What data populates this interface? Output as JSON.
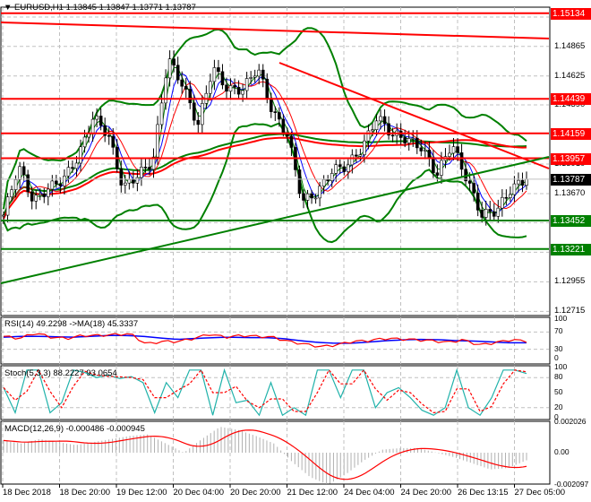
{
  "header": {
    "symbol": "EURUSD,H1",
    "ohlc": "1.13845 1.13847 1.13771 1.13787"
  },
  "price_axis": {
    "ticks": [
      "1.15103",
      "1.14865",
      "1.14625",
      "1.14390",
      "1.13910",
      "1.13670",
      "1.13435",
      "1.13195",
      "1.12955",
      "1.12715"
    ],
    "tags": [
      {
        "v": "1.15134",
        "price": 1.15134,
        "color": "#ff0000"
      },
      {
        "v": "1.14439",
        "price": 1.14439,
        "color": "#ff0000"
      },
      {
        "v": "1.14159",
        "price": 1.14159,
        "color": "#ff0000"
      },
      {
        "v": "1.13957",
        "price": 1.13957,
        "color": "#ff0000"
      },
      {
        "v": "1.13787",
        "price": 1.13787,
        "color": "#000000"
      },
      {
        "v": "1.13452",
        "price": 1.13452,
        "color": "#008000"
      },
      {
        "v": "1.13221",
        "price": 1.13221,
        "color": "#008000"
      }
    ]
  },
  "rsi": {
    "label": "RSI(14) 49.2298  ->MA(18) 45.3337",
    "ticks": [
      "100",
      "70",
      "30",
      "0"
    ]
  },
  "stoch": {
    "label": "Stoch(5,3,3) 88.2227 93.0654",
    "ticks": [
      "100",
      "80",
      "50",
      "20",
      "0"
    ]
  },
  "macd": {
    "label": "MACD(12,26,9) -0.000486 -0.000945",
    "ticks": [
      "0.002026",
      "0.00",
      "-0.002097"
    ]
  },
  "time_axis": [
    "18 Dec 2018",
    "18 Dec 20:00",
    "19 Dec 12:00",
    "20 Dec 04:00",
    "20 Dec 20:00",
    "21 Dec 12:00",
    "24 Dec 04:00",
    "24 Dec 20:00",
    "26 Dec 13:15",
    "27 Dec 05:00"
  ],
  "colors": {
    "up": "#008000",
    "bull": "#ff0000",
    "rsi": "#ff0000",
    "rsi_ma": "#0000ff",
    "stoch_k": "#20b2aa",
    "stoch_d": "#ff0000"
  },
  "series": {
    "close": [
      1.13495,
      1.13895,
      1.13605,
      1.13714,
      1.13786,
      1.13968,
      1.14295,
      1.1415,
      1.13714,
      1.13823,
      1.13932,
      1.14768,
      1.1455,
      1.14223,
      1.14695,
      1.14514,
      1.14514,
      1.14695,
      1.14332,
      1.1415,
      1.13605,
      1.13677,
      1.13859,
      1.13895,
      1.14041,
      1.14295,
      1.1415,
      1.14114,
      1.14041,
      1.13823,
      1.14077,
      1.13786,
      1.13495,
      1.13532,
      1.13714,
      1.13787
    ],
    "rsi": [
      60,
      55,
      68,
      58,
      55,
      62,
      62,
      64,
      66,
      42,
      48,
      48,
      55,
      65,
      58,
      62,
      60,
      58,
      48,
      42,
      36,
      40,
      48,
      50,
      55,
      54,
      52,
      50,
      46,
      52,
      40,
      45,
      52,
      49
    ],
    "rsi_ma": [
      58,
      60,
      60,
      59,
      58,
      60,
      62,
      62,
      60,
      56,
      53,
      55,
      57,
      58,
      57,
      57,
      55,
      50,
      46,
      44,
      44,
      47,
      50,
      52,
      53,
      52,
      50,
      49,
      47,
      45,
      45
    ],
    "stoch": [
      60,
      10,
      95,
      95,
      10,
      30,
      95,
      90,
      80,
      85,
      78,
      82,
      70,
      10,
      70,
      40,
      95,
      95,
      5,
      95,
      30,
      35,
      5,
      70,
      5,
      20,
      5,
      95,
      95,
      40,
      95,
      95,
      20,
      50,
      60,
      40,
      15,
      5,
      20,
      95,
      20,
      5,
      40,
      95,
      95,
      88
    ],
    "macd": [
      0.0008,
      0.0006,
      0.0009,
      0.0007,
      0.0005,
      0.0007,
      0.0009,
      0.0011,
      0.0012,
      0.0006,
      0.0,
      0.0009,
      0.0017,
      0.0015,
      0.0011,
      0.0006,
      -0.0006,
      -0.0016,
      -0.0021,
      -0.0014,
      -0.0005,
      0.0002,
      0.0003,
      0.0003,
      0.0,
      -0.0003,
      -0.0007,
      -0.0011,
      -0.001,
      -0.0005
    ]
  }
}
